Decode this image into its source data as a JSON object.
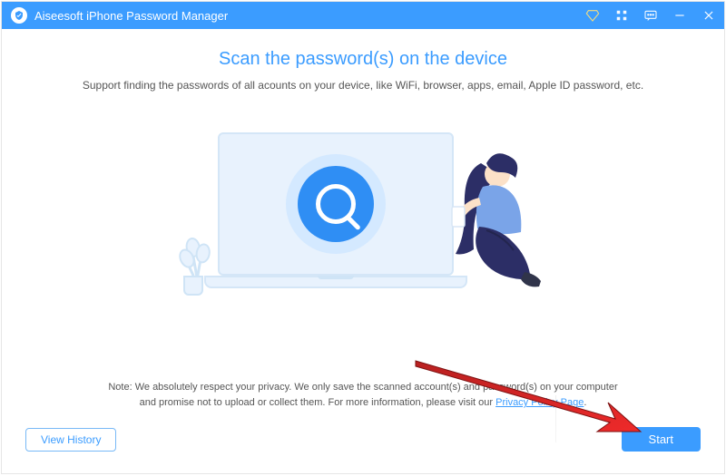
{
  "titlebar": {
    "title": "Aiseesoft iPhone Password Manager"
  },
  "heading": "Scan the password(s) on the device",
  "subheading": "Support finding the passwords of all acounts on your device, like  WiFi, browser, apps, email, Apple ID password, etc.",
  "note": {
    "prefix": "Note: We absolutely respect your privacy. We only save the scanned account(s) and password(s) on your computer and promise not to upload or collect them. For more information, please visit our ",
    "link_text": "Privacy Policy Page",
    "suffix": "."
  },
  "buttons": {
    "view_history": "View History",
    "start": "Start"
  }
}
